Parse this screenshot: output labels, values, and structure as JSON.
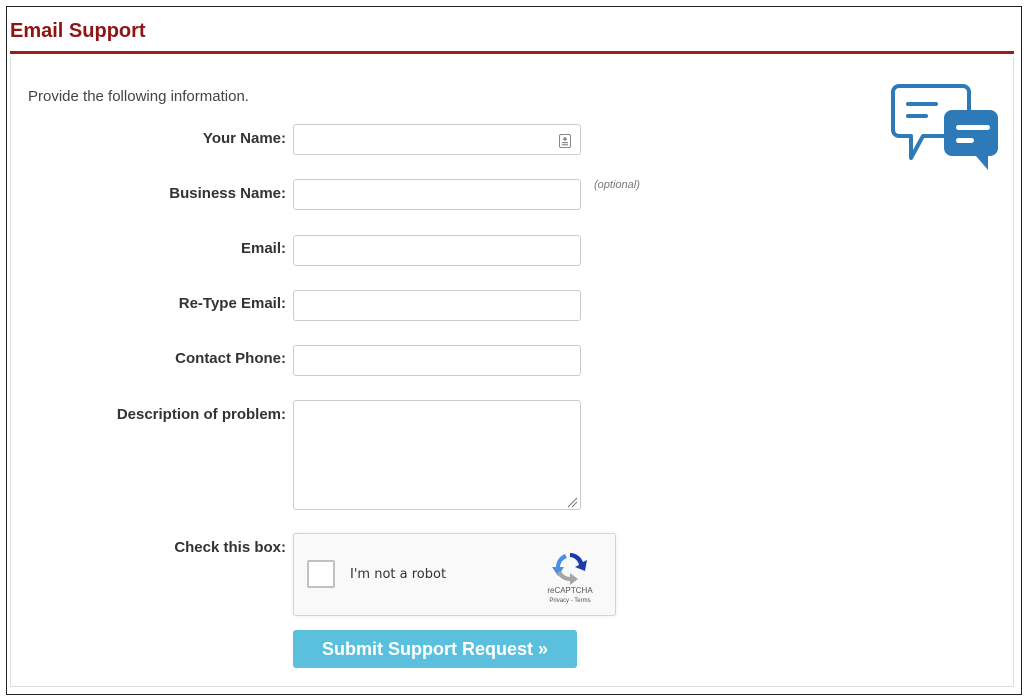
{
  "panel": {
    "title": "Email Support"
  },
  "form": {
    "intro": "Provide the following information.",
    "fields": {
      "your_name": {
        "label": "Your Name:",
        "value": "",
        "placeholder": ""
      },
      "business_name": {
        "label": "Business Name:",
        "value": "",
        "placeholder": "",
        "hint": "(optional)"
      },
      "email": {
        "label": "Email:",
        "value": "",
        "placeholder": ""
      },
      "retype_email": {
        "label": "Re-Type Email:",
        "value": "",
        "placeholder": ""
      },
      "contact_phone": {
        "label": "Contact Phone:",
        "value": "",
        "placeholder": ""
      },
      "description": {
        "label": "Description of problem:",
        "value": "",
        "placeholder": ""
      }
    },
    "captcha": {
      "label": "Check this box:",
      "checkbox_label": "I'm not a robot",
      "brand": "reCAPTCHA",
      "links": "Privacy - Terms",
      "checked": false
    },
    "submit_label": "Submit Support Request »"
  },
  "icons": {
    "chat": "chat-bubbles-icon",
    "contact_card": "contact-card-icon",
    "recaptcha": "recaptcha-logo-icon",
    "resize": "resize-grip-icon"
  },
  "colors": {
    "title": "#8f1414",
    "header_rule": "#a01c1c",
    "chat_icon": "#2e7ab8",
    "submit": "#5bc0de"
  }
}
